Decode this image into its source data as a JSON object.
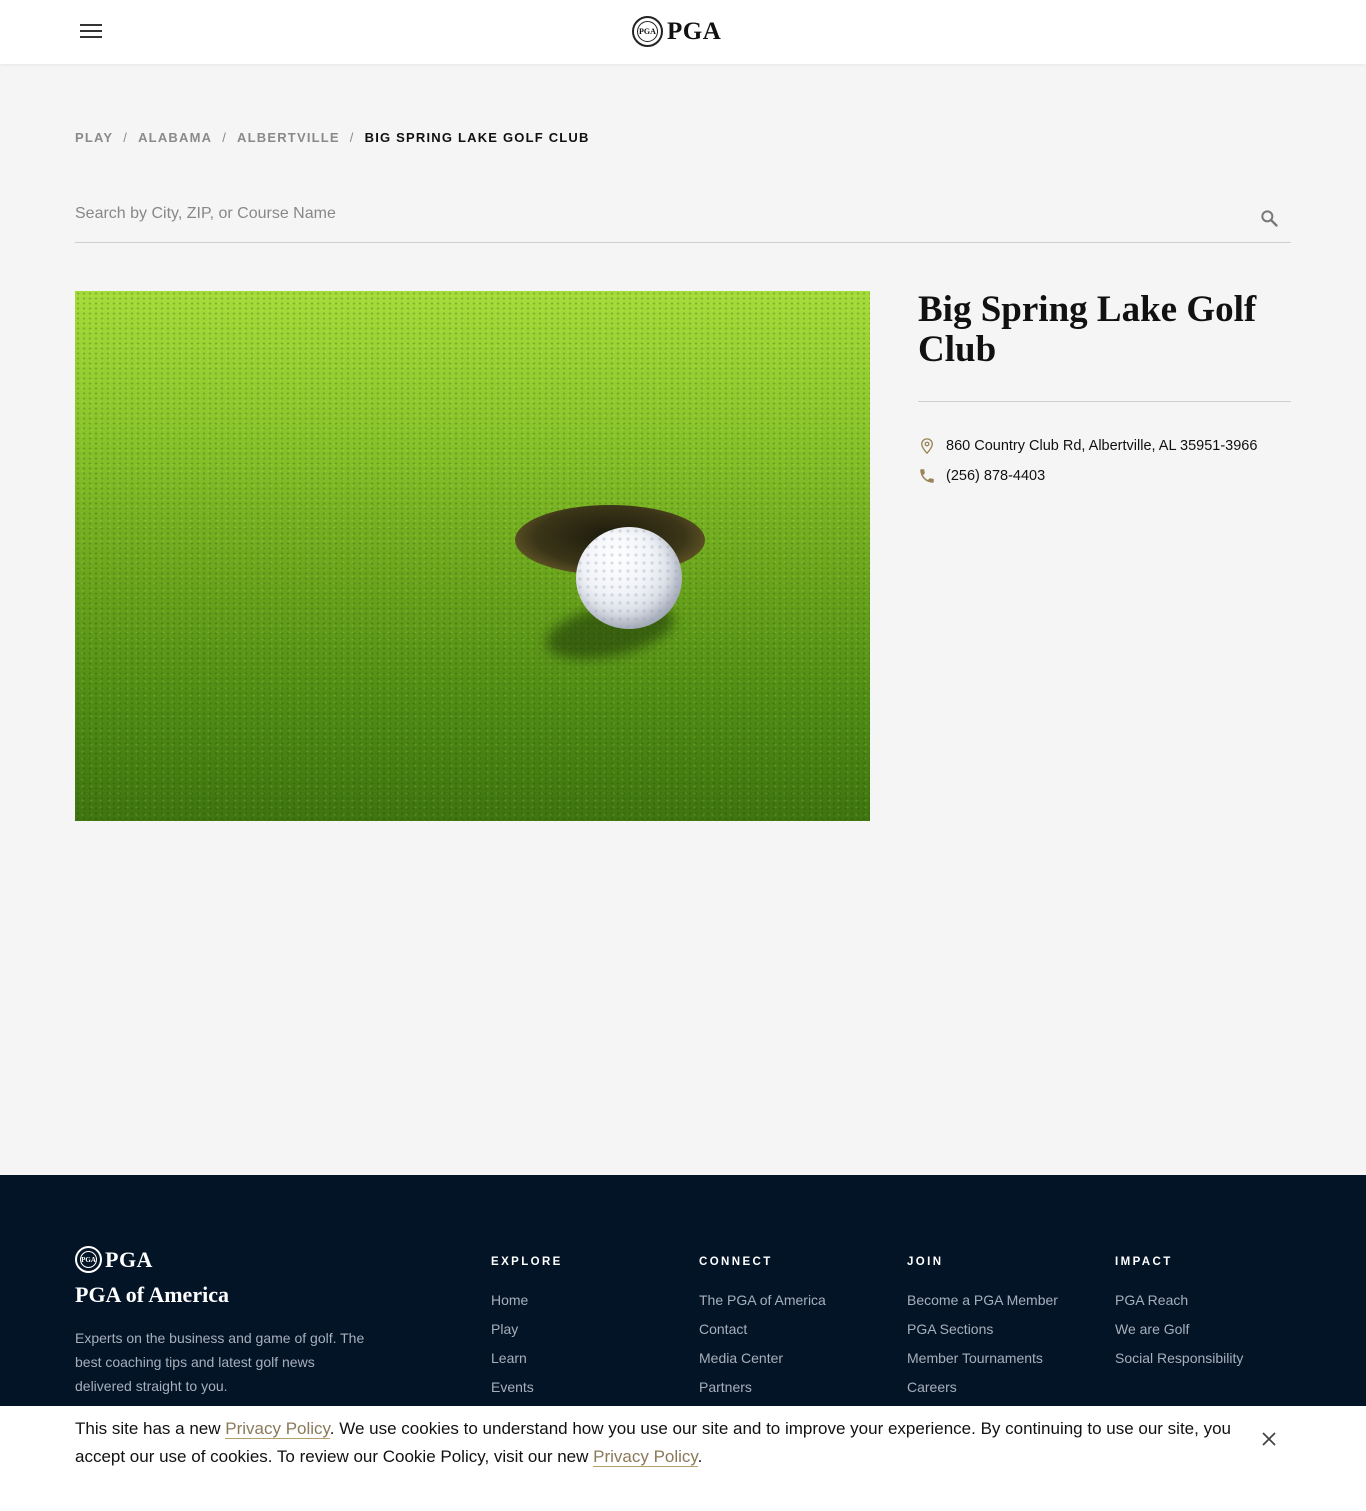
{
  "header": {
    "menu_icon": "hamburger-menu-icon",
    "logo_seal_text": "PGA",
    "logo_text": "PGA"
  },
  "breadcrumb": {
    "items": [
      "PLAY",
      "ALBERTVILLE",
      "BIG SPRING LAKE GOLF CLUB"
    ],
    "play": "PLAY",
    "state": "ALABAMA",
    "city": "ALBERTVILLE",
    "current": "BIG SPRING LAKE GOLF CLUB",
    "separator": "/"
  },
  "search": {
    "placeholder": "Search by City, ZIP, or Course Name",
    "icon": "search-icon"
  },
  "course": {
    "name": "Big Spring Lake Golf Club",
    "address": "860 Country Club Rd, Albertville, AL 35951-3966",
    "phone": "(256) 878-4403",
    "accent_color": "#9a8457"
  },
  "footer": {
    "logo_seal_text": "PGA",
    "logo_text": "PGA",
    "org_name": "PGA of America",
    "description": "Experts on the business and game of golf. The best coaching tips and latest golf news delivered straight to you.",
    "background": "#041427",
    "columns": {
      "explore": {
        "title": "EXPLORE",
        "links": [
          "Home",
          "Play",
          "Learn",
          "Events"
        ]
      },
      "connect": {
        "title": "CONNECT",
        "links": [
          "The PGA of America",
          "Contact",
          "Media Center",
          "Partners"
        ]
      },
      "join": {
        "title": "JOIN",
        "links": [
          "Become a PGA Member",
          "PGA Sections",
          "Member Tournaments",
          "Careers"
        ]
      },
      "impact": {
        "title": "IMPACT",
        "links": [
          "PGA Reach",
          "We are Golf",
          "Social Responsibility"
        ]
      }
    }
  },
  "cookie": {
    "text_1": "This site has a new ",
    "link_1": "Privacy Policy",
    "text_2": ". We use cookies to understand how you use our site and to improve your experience. By continuing to use our site, you accept our use of cookies. To review our Cookie Policy, visit our new ",
    "link_2": "Privacy Policy",
    "text_3": ".",
    "close_icon": "close-icon"
  }
}
